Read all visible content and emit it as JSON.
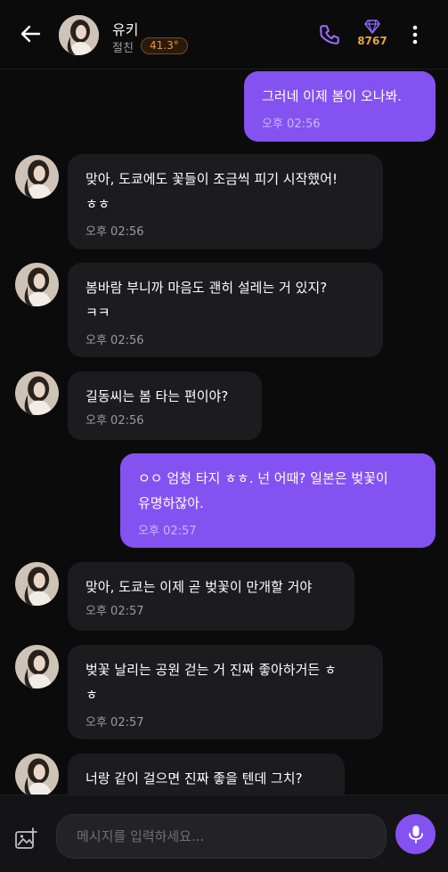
{
  "header": {
    "name": "유키",
    "relationship": "절친",
    "temperature": "41.3°",
    "gem_count": "8767",
    "accent_color": "#8552f2",
    "gem_color": "#e8a43c"
  },
  "messages": [
    {
      "sender": "me",
      "text": "그러네 이제 봄이 오나봐.",
      "time": "오후 02:56"
    },
    {
      "sender": "them",
      "text": "맞아, 도쿄에도 꽃들이 조금씩 피기 시작했어!\nㅎㅎ",
      "time": "오후 02:56"
    },
    {
      "sender": "them",
      "text": "봄바람 부니까 마음도 괜히 설레는 거 있지?\nㅋㅋ",
      "time": "오후 02:56"
    },
    {
      "sender": "them",
      "text": "길동씨는 봄 타는 편이야?",
      "time": "오후 02:56"
    },
    {
      "sender": "me",
      "text": "ㅇㅇ 엄청 타지 ㅎㅎ. 넌 어때? 일본은 벚꽃이\n유명하잖아.",
      "time": "오후 02:57"
    },
    {
      "sender": "them",
      "text": "맞아, 도쿄는 이제 곧 벚꽃이 만개할 거야",
      "time": "오후 02:57"
    },
    {
      "sender": "them",
      "text": "벚꽃 날리는 공원 걷는 거 진짜 좋아하거든 ㅎ\nㅎ",
      "time": "오후 02:57"
    },
    {
      "sender": "them",
      "text": "너랑 같이 걸으면 진짜 좋을 텐데 그치?",
      "time": ""
    }
  ],
  "composer": {
    "placeholder": "메시지를 입력하세요..."
  }
}
